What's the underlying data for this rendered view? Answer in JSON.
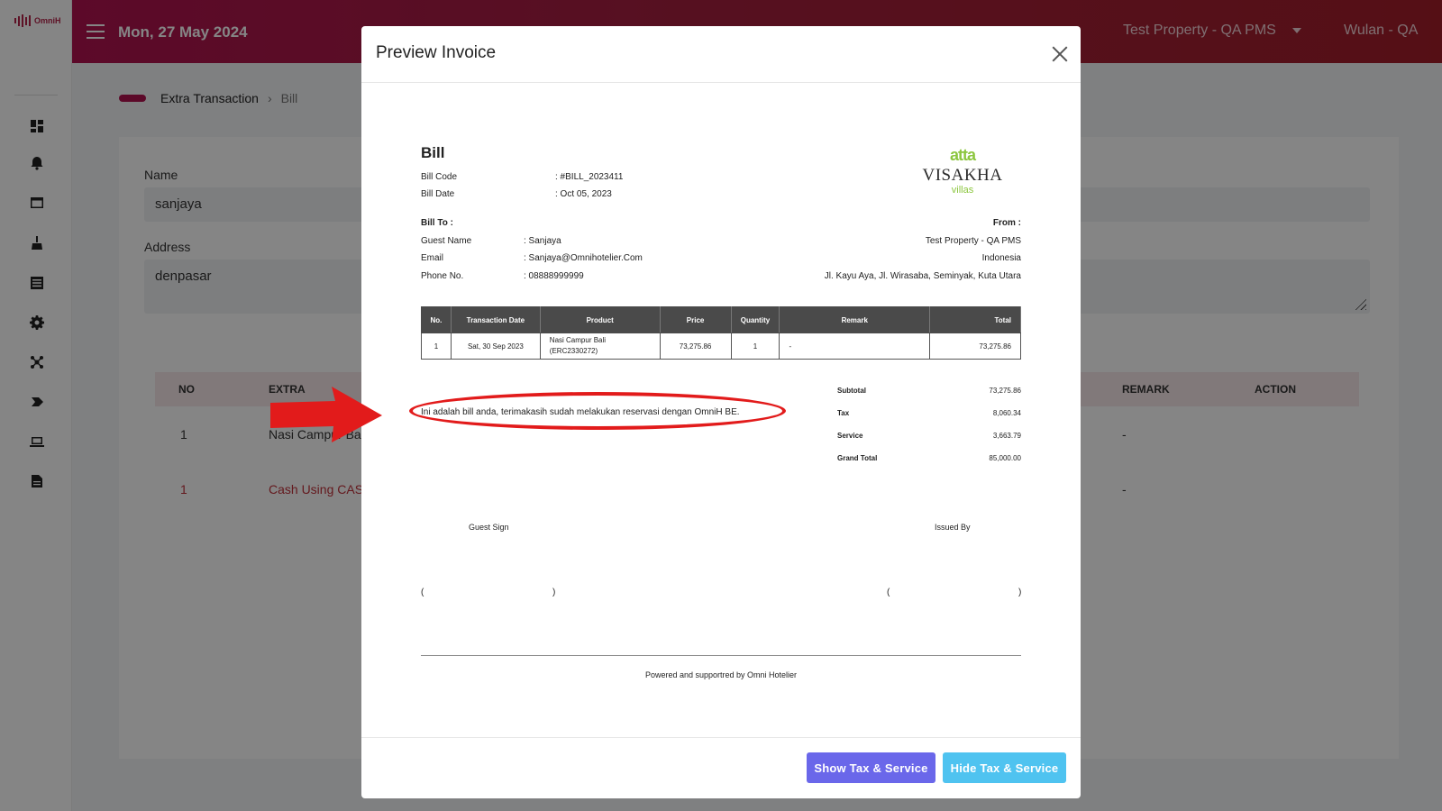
{
  "app": {
    "logo_text": "OmniH",
    "date": "Mon, 27 May 2024",
    "property": "Test Property - QA PMS",
    "user": "Wulan - QA"
  },
  "sidebar": {
    "icons": [
      "dashboard-icon",
      "bell-icon",
      "window-icon",
      "broom-icon",
      "list-icon",
      "gear-icon",
      "network-icon",
      "tag-icon",
      "laptop-icon",
      "document-icon"
    ]
  },
  "breadcrumb": {
    "parent": "Extra Transaction",
    "separator": "›",
    "current": "Bill"
  },
  "form": {
    "name_label": "Name",
    "name_value": "sanjaya",
    "address_label": "Address",
    "address_value": "denpasar"
  },
  "bg_table": {
    "headers": [
      "NO",
      "EXTRA",
      "REMARK",
      "ACTION"
    ],
    "rows": [
      {
        "no": "1",
        "extra": "Nasi Campur Ba",
        "remark": "-"
      },
      {
        "no": "1",
        "extra": "Cash Using CAS",
        "remark": "-"
      }
    ]
  },
  "modal": {
    "title": "Preview Invoice",
    "show_button": "Show Tax & Service",
    "hide_button": "Hide Tax & Service"
  },
  "invoice": {
    "title": "Bill",
    "bill_code_label": "Bill Code",
    "bill_code_value": ": #BILL_2023411",
    "bill_date_label": "Bill Date",
    "bill_date_value": ": Oct 05, 2023",
    "bill_to_label": "Bill To :",
    "from_label": "From :",
    "guest_name_label": "Guest Name",
    "guest_name_value": ": Sanjaya",
    "email_label": "Email",
    "email_value": ": Sanjaya@Omnihotelier.Com",
    "phone_label": "Phone No.",
    "phone_value": ": 08888999999",
    "from_property": "Test Property - QA PMS",
    "from_country": "Indonesia",
    "from_address": "Jl. Kayu Aya, Jl. Wirasaba, Seminyak, Kuta Utara",
    "brand": {
      "top": "atta",
      "name": "VISAKHA",
      "sub": "villas"
    },
    "table_headers": [
      "No.",
      "Transaction Date",
      "Product",
      "Price",
      "Quantity",
      "Remark",
      "Total"
    ],
    "items": [
      {
        "no": "1",
        "date": "Sat, 30 Sep 2023",
        "product_line1": "Nasi Campur Bali",
        "product_line2": "(ERC2330272)",
        "price": "73,275.86",
        "quantity": "1",
        "remark": "-",
        "total": "73,275.86"
      }
    ],
    "summary": {
      "subtotal_label": "Subtotal",
      "subtotal_value": "73,275.86",
      "tax_label": "Tax",
      "tax_value": "8,060.34",
      "service_label": "Service",
      "service_value": "3,663.79",
      "grand_total_label": "Grand Total",
      "grand_total_value": "85,000.00"
    },
    "note": "Ini adalah bill anda, terimakasih sudah melakukan reservasi dengan OmniH BE.",
    "guest_sign_label": "Guest Sign",
    "issued_by_label": "Issued By",
    "paren_open": "(",
    "paren_close": ")",
    "powered_by": "Powered and supportred by Omni Hotelier"
  },
  "annotation": {
    "color": "#e21b1b"
  }
}
